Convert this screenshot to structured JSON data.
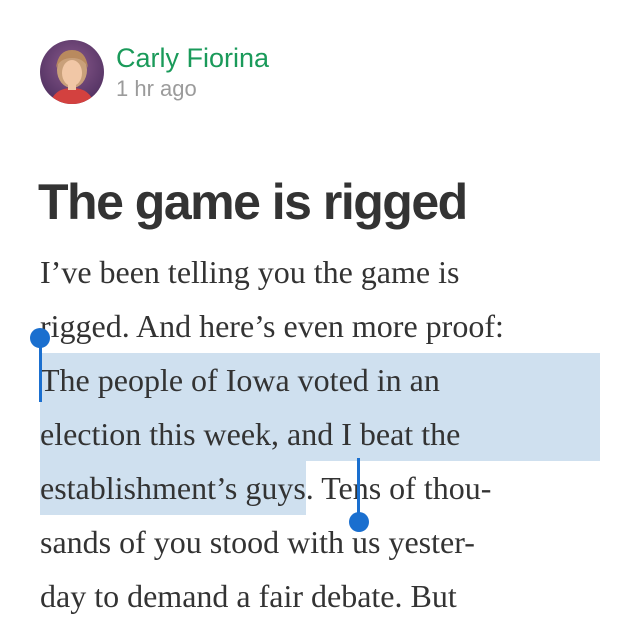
{
  "post": {
    "author": "Carly Fiorina",
    "time": "1 hr ago",
    "title": "The game is rigged",
    "lines": [
      "I’ve been telling you the game is",
      "rigged. And here’s even more proof:",
      "The people of Iowa voted in an",
      "election this week, and I beat the",
      "establishment’s guys",
      ". Tens of thou-",
      "sands of you stood with us yester-",
      "day to demand a fair debate. But"
    ]
  },
  "colors": {
    "author": "#1a9a5a",
    "timestamp": "#9b9b9b",
    "text": "#333333",
    "selection": "#cfe0ef",
    "handle": "#1a6fcf"
  },
  "icons": {
    "avatar": "author-photo"
  }
}
